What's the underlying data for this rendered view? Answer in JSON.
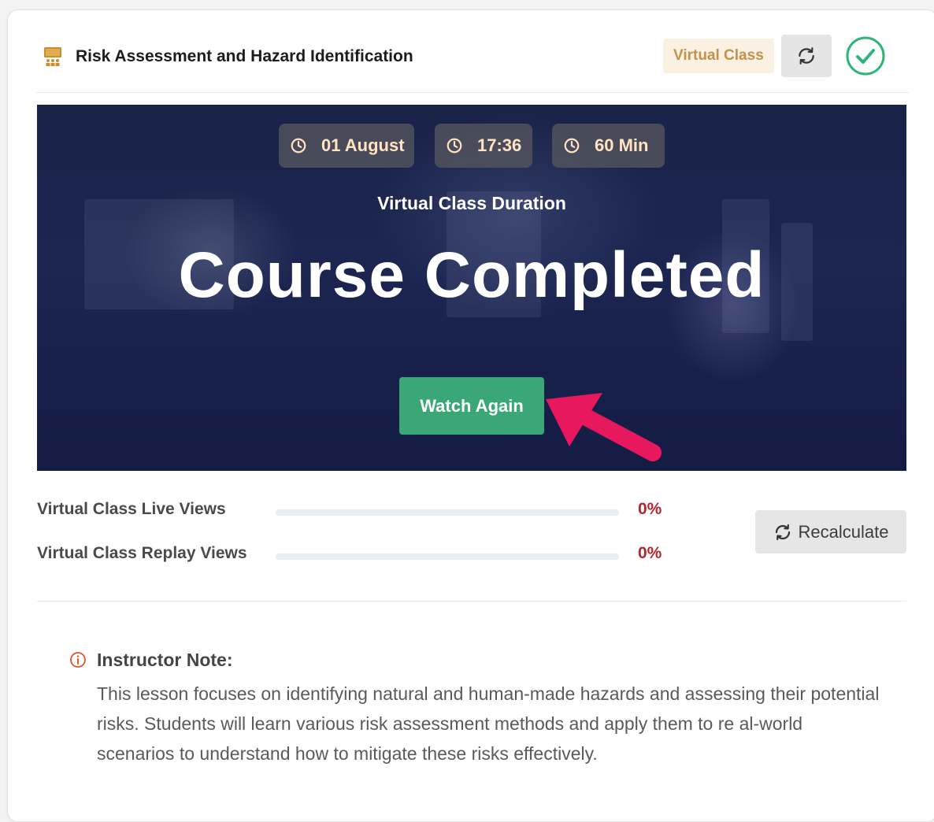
{
  "header": {
    "title": "Risk Assessment and Hazard Identification",
    "badge": "Virtual Class",
    "title_icon": "classroom-icon",
    "refresh_icon": "refresh-icon",
    "status_icon": "check-circle-icon"
  },
  "hero": {
    "pills": [
      {
        "icon": "clock-icon",
        "text": "01 August"
      },
      {
        "icon": "clock-icon",
        "text": "17:36"
      },
      {
        "icon": "clock-icon",
        "text": "60 Min"
      }
    ],
    "duration_label": "Virtual Class Duration",
    "status_text": "Course Completed",
    "watch_button": "Watch Again"
  },
  "views": {
    "live": {
      "label": "Virtual Class Live Views",
      "percent_text": "0%",
      "percent": 0
    },
    "replay": {
      "label": "Virtual Class Replay Views",
      "percent_text": "0%",
      "percent": 0
    },
    "recalculate_button": "Recalculate"
  },
  "note": {
    "title": "Instructor Note:",
    "text": "This lesson focuses on identifying natural and human-made hazards and assessing their potential risks. Students will learn various risk assessment methods and apply them to re al-world scenarios to understand how to mitigate these risks effectively."
  },
  "colors": {
    "accent_green": "#3aa876",
    "badge_bg": "#fbf1e2",
    "badge_text": "#c2914d",
    "percent_red": "#b3262d",
    "arrow_pink": "#e8185f",
    "note_icon": "#e0552b"
  }
}
